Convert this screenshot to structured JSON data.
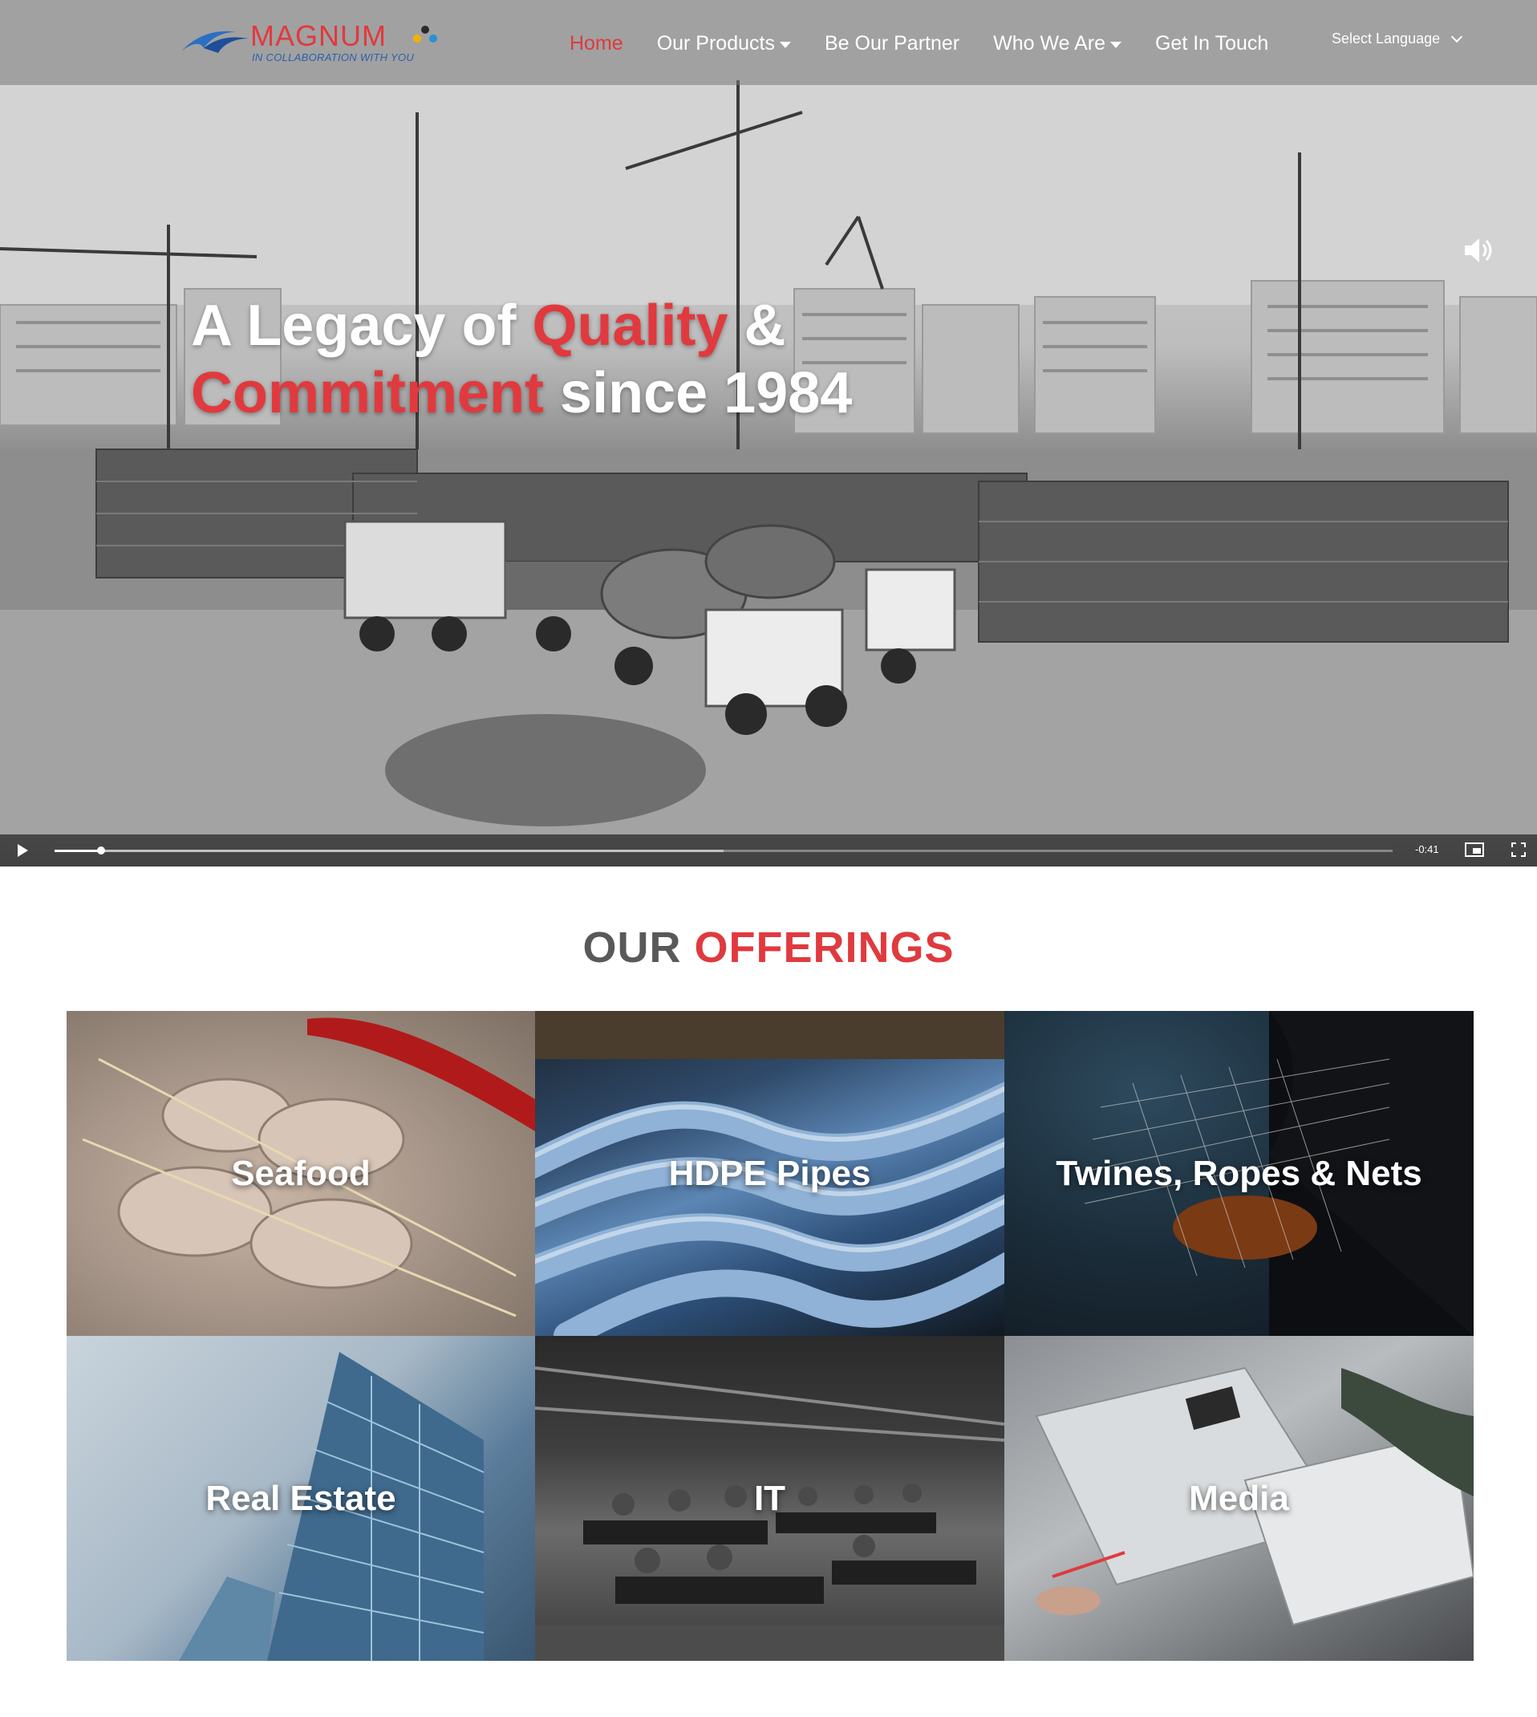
{
  "header": {
    "logo": {
      "word": "MAGNUM",
      "tagline": "IN COLLABORATION WITH YOU"
    },
    "nav": [
      {
        "label": "Home",
        "active": true,
        "dropdown": false
      },
      {
        "label": "Our Products",
        "active": false,
        "dropdown": true
      },
      {
        "label": "Be Our Partner",
        "active": false,
        "dropdown": false
      },
      {
        "label": "Who We Are",
        "active": false,
        "dropdown": true
      },
      {
        "label": "Get In Touch",
        "active": false,
        "dropdown": false
      }
    ],
    "language_select": "Select Language"
  },
  "hero": {
    "headline": {
      "part1": "A Legacy of ",
      "part2_red": "Quality",
      "part3": " &",
      "part4_red": "Commitment",
      "part5": " since 1984"
    },
    "video": {
      "time_remaining": "-0:41",
      "progress": 0.035,
      "buffered": 0.5
    }
  },
  "offerings": {
    "title_grey": "OUR",
    "title_red": "OFFERINGS",
    "tiles": [
      {
        "label": "Seafood"
      },
      {
        "label": "HDPE Pipes"
      },
      {
        "label": "Twines, Ropes & Nets"
      },
      {
        "label": "Real Estate"
      },
      {
        "label": "IT"
      },
      {
        "label": "Media"
      }
    ]
  },
  "colors": {
    "accent": "#e03a3e",
    "title_grey": "#595959",
    "brand_blue": "#2b5fa8"
  }
}
